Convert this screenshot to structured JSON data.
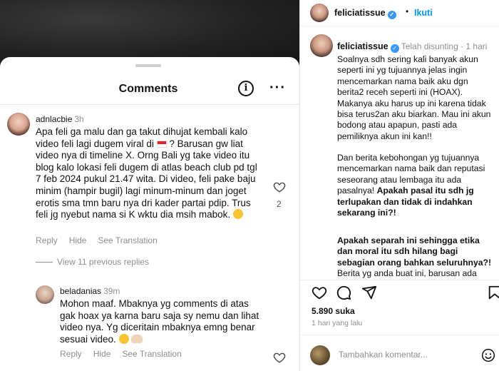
{
  "left": {
    "sheet_title": "Comments",
    "info_icon": "i",
    "more_icon": "···",
    "comment1": {
      "username": "adnlacbie",
      "time": "3h",
      "text_a": "Apa feli ga malu dan ga takut dihujat kembali kalo video feli lagi dugem viral di",
      "text_b": "? Barusan gw liat video nya di timeline X. Orng Bali yg take video itu blog kalo lokasi feli dugem di atlas beach club pd tgl 7 feb 2024 pukul 21.47 wita. Di video, feli pake baju minim (hampir bugil) lagi minum-minum dan joget erotis sma tmn baru nya dri kader partai pdip. Trus feli jg nyebut nama si K wktu dia msih mabok.",
      "likes": "2",
      "reply": "Reply",
      "hide": "Hide",
      "see_translation": "See Translation"
    },
    "view_previous": "View 11 previous replies",
    "comment2": {
      "username": "beladanias",
      "time": "39m",
      "text": "Mohon maaf. Mbaknya yg comments di atas gak hoax ya karna baru saja sy nemu dan lihat video nya. Yg diceritain mbaknya emng benar sesuai video.",
      "reply": "Reply",
      "hide": "Hide",
      "see_translation": "See Translation"
    }
  },
  "right": {
    "username": "feliciatissue",
    "dot": "•",
    "follow": "Ikuti",
    "caption_meta": "Telah disunting · 1 hari",
    "caption_p1": "Soalnya sdh sering kali banyak akun seperti ini yg tujuannya jelas ingin mencemarkan nama baik aku dgn berita2 receh seperti ini (HOAX). Makanya aku harus up ini karena tidak bisa terus2an aku biarkan. Mau ini akun bodong atau apapun, pasti ada pemiliknya akun ini kan!!",
    "caption_p2_normal": "Dan berita kebohongan yg tujuannya mencemarkan nama baik dan reputasi seseorang atau lembaga itu ada pasalnya!",
    "caption_p2_bold": "Apakah pasal itu sdh jg terlupakan dan tidak di indahkan sekarang ini?!",
    "caption_p3": "Apakah separah ini sehingga etika dan moral itu sdh hilang bagi sebagian orang bahkan seluruhnya?!",
    "caption_p4": "Berita yg anda buat ini, barusan ada",
    "likes": "5.890 suka",
    "posted": "1 hari yang lalu",
    "add_comment_placeholder": "Tambahkan komentar..."
  },
  "icons": [
    "info-icon",
    "more-icon",
    "heart-icon",
    "like-icon",
    "comment-icon",
    "share-icon",
    "save-icon",
    "emoji-icon",
    "verified-icon",
    "flag-indonesia-icon"
  ]
}
